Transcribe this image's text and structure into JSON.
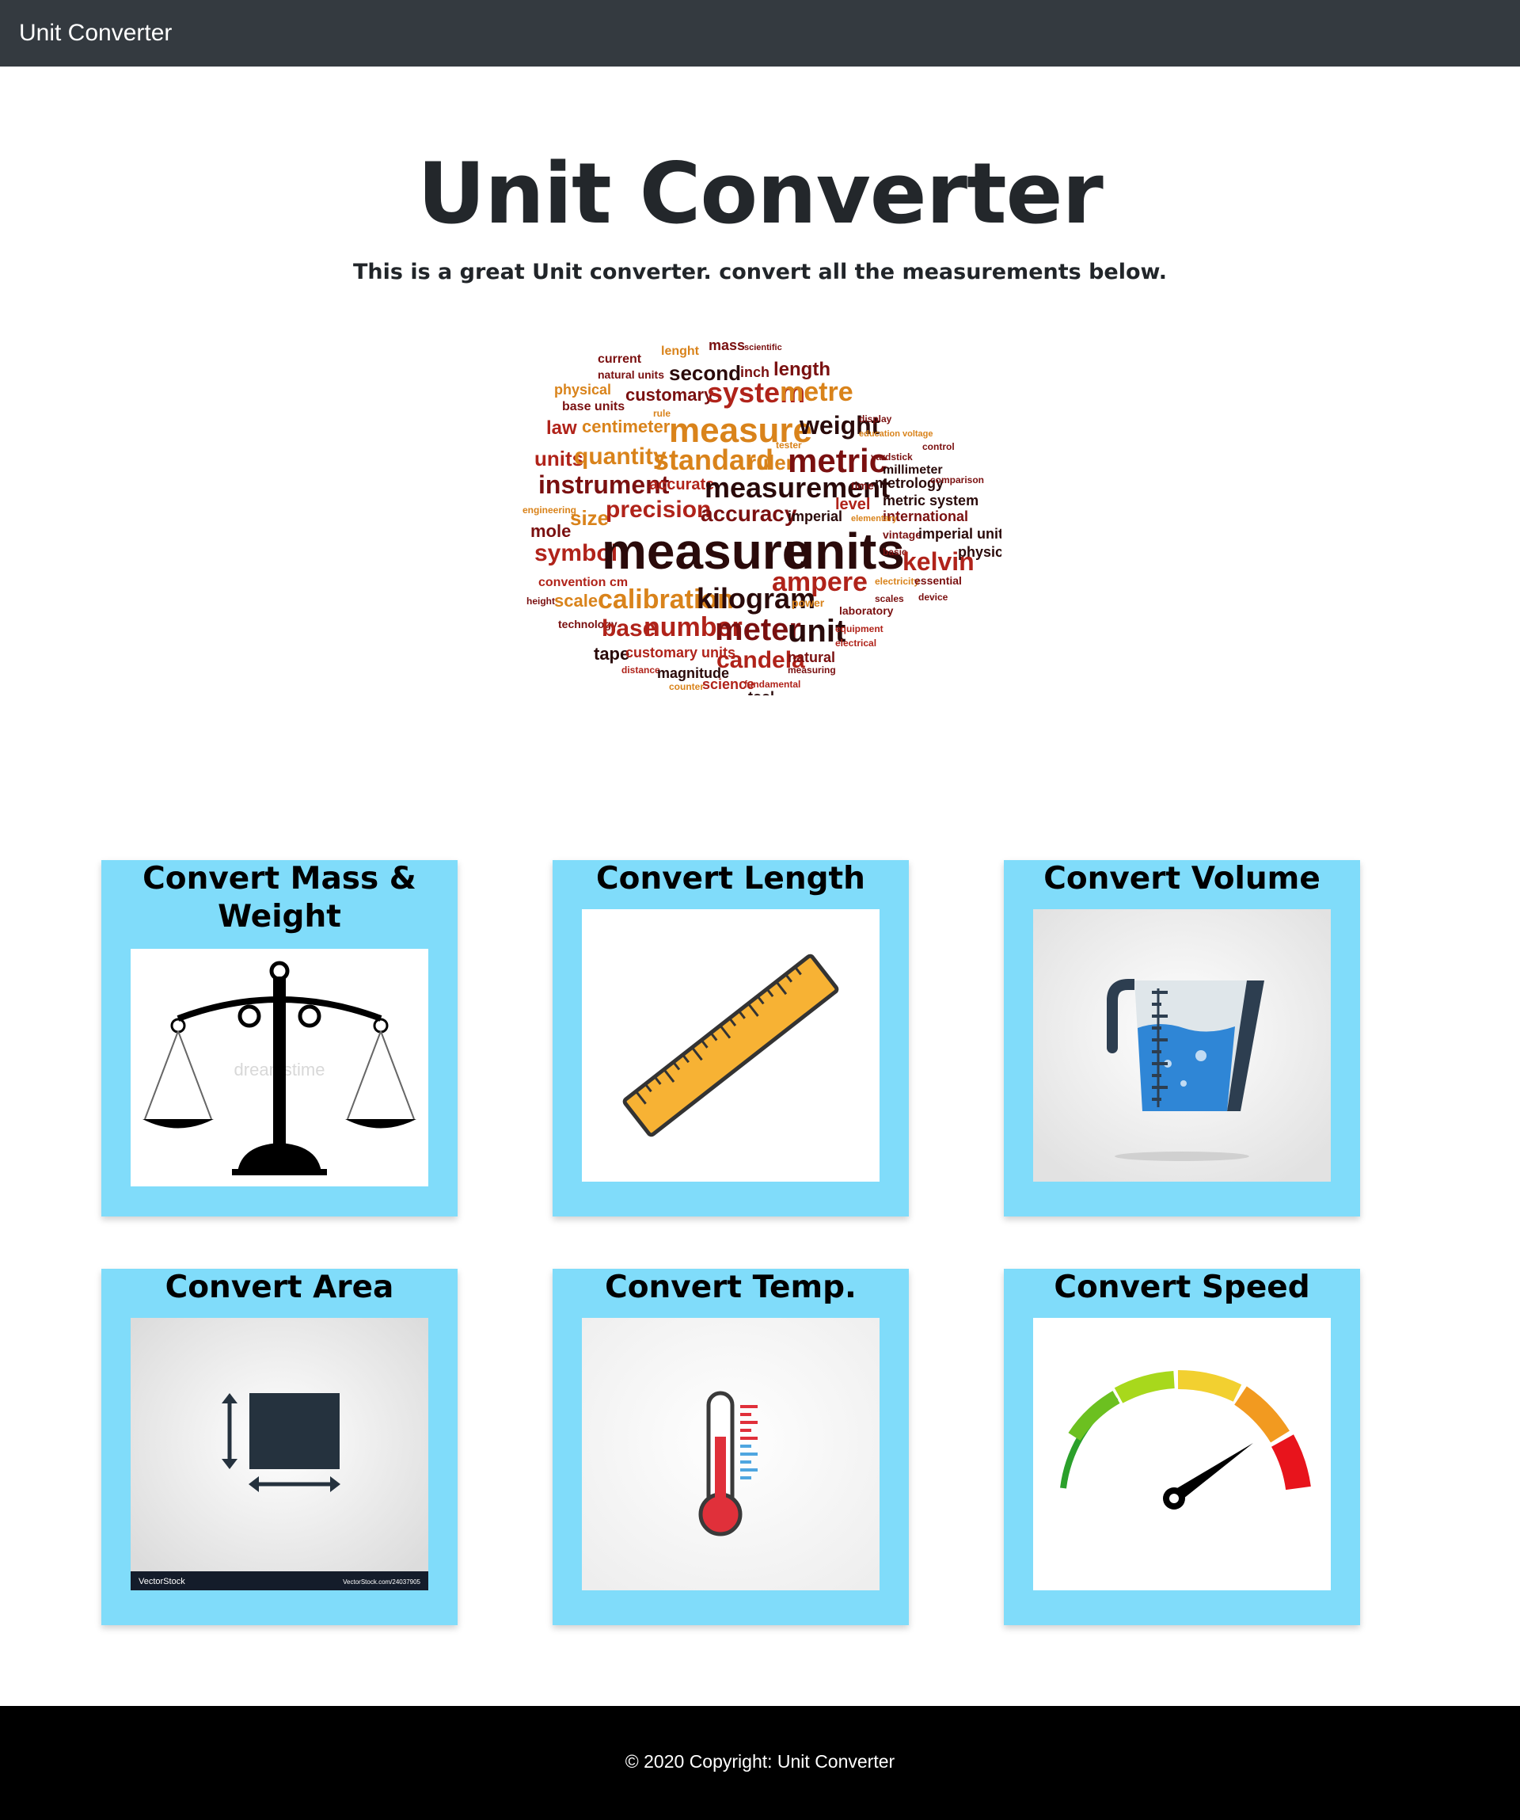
{
  "navbar": {
    "brand": "Unit Converter"
  },
  "hero": {
    "title": "Unit Converter",
    "subtitle": "This is a great Unit converter. convert all the measurements below.",
    "image_icon": "measurement-word-cloud"
  },
  "cards": [
    {
      "title": "Convert Mass & Weight",
      "icon": "balance-scale-icon"
    },
    {
      "title": "Convert Length",
      "icon": "ruler-icon"
    },
    {
      "title": "Convert Volume",
      "icon": "measuring-jug-icon"
    },
    {
      "title": "Convert Area",
      "icon": "area-square-icon"
    },
    {
      "title": "Convert Temp.",
      "icon": "thermometer-icon"
    },
    {
      "title": "Convert Speed",
      "icon": "speedometer-icon"
    }
  ],
  "footer": {
    "copyright": "© 2020 Copyright: Unit Converter"
  },
  "colors": {
    "navbar": "#343a40",
    "card": "#80dcfa",
    "footer": "#000000",
    "title": "#23272b"
  }
}
